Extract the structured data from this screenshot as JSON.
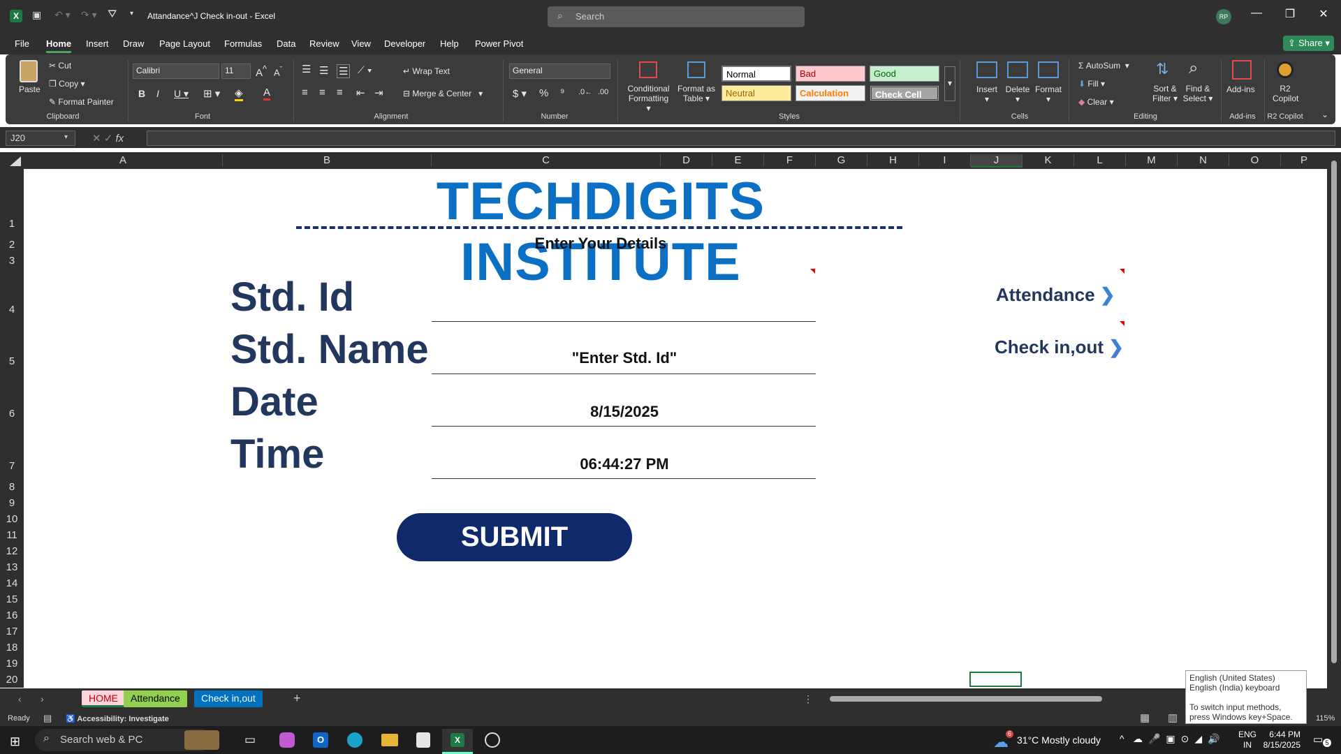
{
  "window": {
    "title": "Attandance^J Check in-out  -  Excel",
    "search_placeholder": "Search",
    "user_initials": "RP"
  },
  "menu": [
    "File",
    "Home",
    "Insert",
    "Draw",
    "Page Layout",
    "Formulas",
    "Data",
    "Review",
    "View",
    "Developer",
    "Help",
    "Power Pivot"
  ],
  "share_label": "Share",
  "ribbon": {
    "clipboard": {
      "paste": "Paste",
      "cut": "Cut",
      "copy": "Copy",
      "format_painter": "Format Painter",
      "group": "Clipboard"
    },
    "font": {
      "name": "Calibri",
      "size": "11",
      "group": "Font"
    },
    "alignment": {
      "wrap": "Wrap Text",
      "merge": "Merge & Center",
      "group": "Alignment"
    },
    "number": {
      "format": "General",
      "group": "Number"
    },
    "styles_group": {
      "conditional": "Conditional",
      "conditional2": "Formatting",
      "format_as": "Format as",
      "table": "Table",
      "group": "Styles"
    },
    "styles": {
      "normal": "Normal",
      "bad": "Bad",
      "good": "Good",
      "neutral": "Neutral",
      "calculation": "Calculation",
      "check": "Check Cell"
    },
    "cells": {
      "insert": "Insert",
      "delete": "Delete",
      "format": "Format",
      "group": "Cells"
    },
    "editing": {
      "autosum": "AutoSum",
      "fill": "Fill",
      "clear": "Clear",
      "sort": "Sort &",
      "filter": "Filter",
      "find": "Find &",
      "select": "Select",
      "group": "Editing"
    },
    "addins": {
      "label": "Add-ins",
      "group": "Add-ins"
    },
    "copilot": {
      "label1": "R2",
      "label2": "Copilot",
      "group": "R2 Copilot"
    }
  },
  "formula_bar": {
    "name_box": "J20",
    "value": ""
  },
  "columns": [
    "A",
    "B",
    "C",
    "D",
    "E",
    "F",
    "G",
    "H",
    "I",
    "J",
    "K",
    "L",
    "M",
    "N",
    "O",
    "P"
  ],
  "rows": [
    "1",
    "2",
    "3",
    "4",
    "5",
    "6",
    "7",
    "8",
    "9",
    "10",
    "11",
    "12",
    "13",
    "14",
    "15",
    "16",
    "17",
    "18",
    "19",
    "20"
  ],
  "form": {
    "title": "TECHDIGITS INSTITUTE",
    "subtitle": "Enter Your Details",
    "fields": [
      {
        "label": "Std. Id",
        "value": ""
      },
      {
        "label": "Std. Name",
        "value": "\"Enter Std. Id\""
      },
      {
        "label": "Date",
        "value": "8/15/2025"
      },
      {
        "label": "Time",
        "value": "06:44:27 PM"
      }
    ],
    "submit": "SUBMIT",
    "nav": {
      "attendance": "Attendance",
      "checkin": "Check in,out"
    }
  },
  "sheets": [
    {
      "name": "HOME",
      "active": true
    },
    {
      "name": "Attendance",
      "active": false
    },
    {
      "name": "Check in,out",
      "active": false
    }
  ],
  "status": {
    "ready": "Ready",
    "accessibility": "Accessibility: Investigate",
    "zoom": "115%"
  },
  "tooltip": {
    "line1": "English (United States)",
    "line2": "English (India) keyboard",
    "line3": "To switch input methods, press Windows key+Space."
  },
  "taskbar": {
    "search": "Search web & PC",
    "weather_temp": "31°C",
    "weather_desc": "Mostly cloudy",
    "weather_badge": "6",
    "lang1": "ENG",
    "lang2": "IN",
    "time": "6:44 PM",
    "date": "8/15/2025",
    "notif": "5"
  },
  "colors": {
    "accent": "#1e7a45",
    "title_blue": "#0b6fc4",
    "navy": "#22375e",
    "submit": "#0f2a6b"
  }
}
